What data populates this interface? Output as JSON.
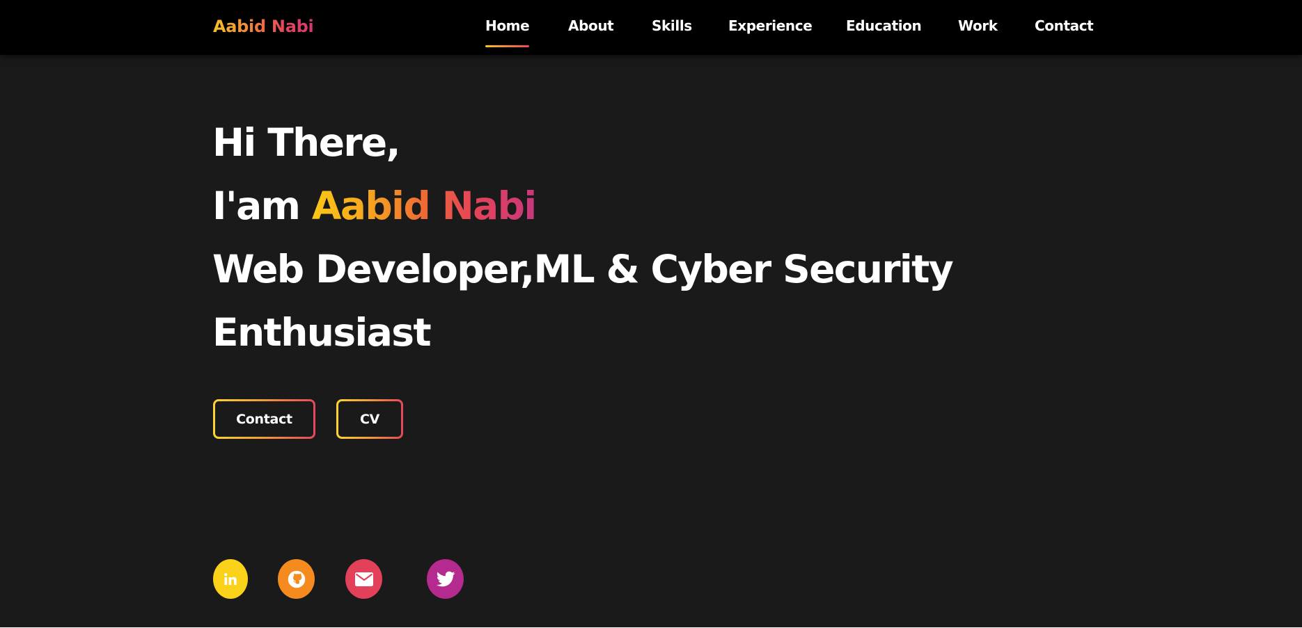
{
  "brand": {
    "name": "Aabid Nabi"
  },
  "nav": {
    "items": [
      {
        "label": "Home",
        "active": true
      },
      {
        "label": "About"
      },
      {
        "label": "Skills"
      },
      {
        "label": "Experience"
      },
      {
        "label": "Education"
      },
      {
        "label": "Work"
      },
      {
        "label": "Contact"
      }
    ]
  },
  "hero": {
    "greeting": "Hi There,",
    "intro_prefix": "I'am",
    "name": "Aabid Nabi",
    "role_line_1": "Web Developer,ML & Cyber Security",
    "role_line_2": "Enthusiast",
    "buttons": {
      "contact": "Contact",
      "cv": "CV"
    }
  },
  "social": [
    {
      "icon": "linkedin-icon",
      "color": "#fbd21a"
    },
    {
      "icon": "github-icon",
      "color": "#f58a1f"
    },
    {
      "icon": "envelope-icon",
      "color": "#e3415a"
    },
    {
      "icon": "twitter-icon",
      "color": "#b42a8e"
    }
  ],
  "colors": {
    "accent_start": "#fbc717",
    "accent_end": "#c8377d",
    "background": "#1a1a1a",
    "navbar": "#000000"
  }
}
